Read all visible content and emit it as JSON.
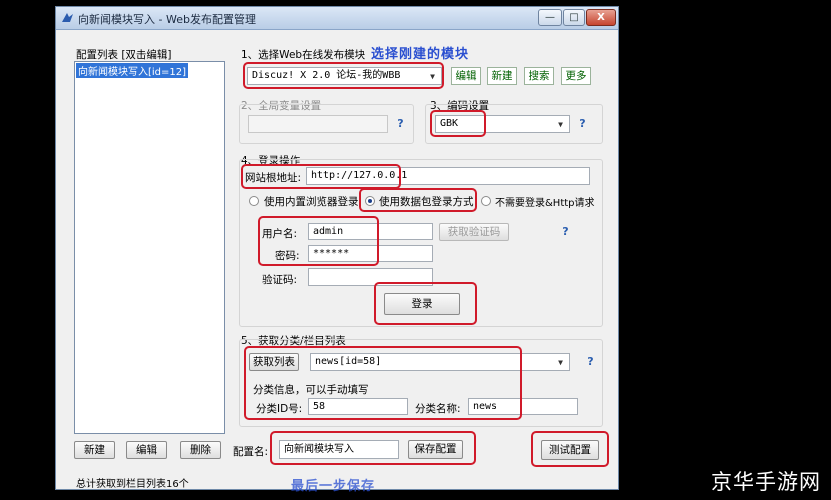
{
  "window": {
    "title": "向新闻模块写入 - Web发布配置管理",
    "minimize": "—",
    "maximize": "□",
    "close": "X"
  },
  "left": {
    "list_label": "配置列表 [双击编辑]",
    "items": [
      "向新闻模块写入[id=12]"
    ],
    "new_btn": "新建",
    "edit_btn": "编辑",
    "delete_btn": "删除",
    "status": "总计获取到栏目列表16个"
  },
  "section1": {
    "label": "1、选择Web在线发布模块",
    "module": "Discuz! X 2.0 论坛-我的WBB",
    "edit_btn": "编辑",
    "new_btn": "新建",
    "search_btn": "搜索",
    "more_btn": "更多",
    "annotation": "选择刚建的模块"
  },
  "section2": {
    "label": "2、全局变量设置"
  },
  "section3": {
    "label": "3、编码设置",
    "encoding": "GBK"
  },
  "section4": {
    "label": "4、登录操作",
    "site_label": "网站根地址:",
    "site_url": "http://127.0.0.1",
    "radio_builtin": "使用内置浏览器登录",
    "radio_packet": "使用数据包登录方式",
    "radio_none": "不需要登录&Http请求",
    "username_label": "用户名:",
    "username": "admin",
    "password_label": "密码:",
    "password": "******",
    "captcha_label": "验证码:",
    "get_captcha_btn": "获取验证码",
    "login_btn": "登录"
  },
  "section5": {
    "label": "5、获取分类/栏目列表",
    "fetch_btn": "获取列表",
    "category": "news[id=58]",
    "info_label": "分类信息，可以手动填写",
    "id_label": "分类ID号:",
    "id_value": "58",
    "name_label": "分类名称:",
    "name_value": "news"
  },
  "bottom": {
    "config_name_label": "配置名:",
    "config_name": "向新闻模块写入",
    "save_btn": "保存配置",
    "test_btn": "测试配置",
    "annotation": "最后一步保存"
  },
  "watermark": "京华手游网",
  "colors": {
    "highlight_red": "#d01a2a",
    "annotation_blue": "#2a4fd0",
    "selection_blue": "#3074d8"
  }
}
